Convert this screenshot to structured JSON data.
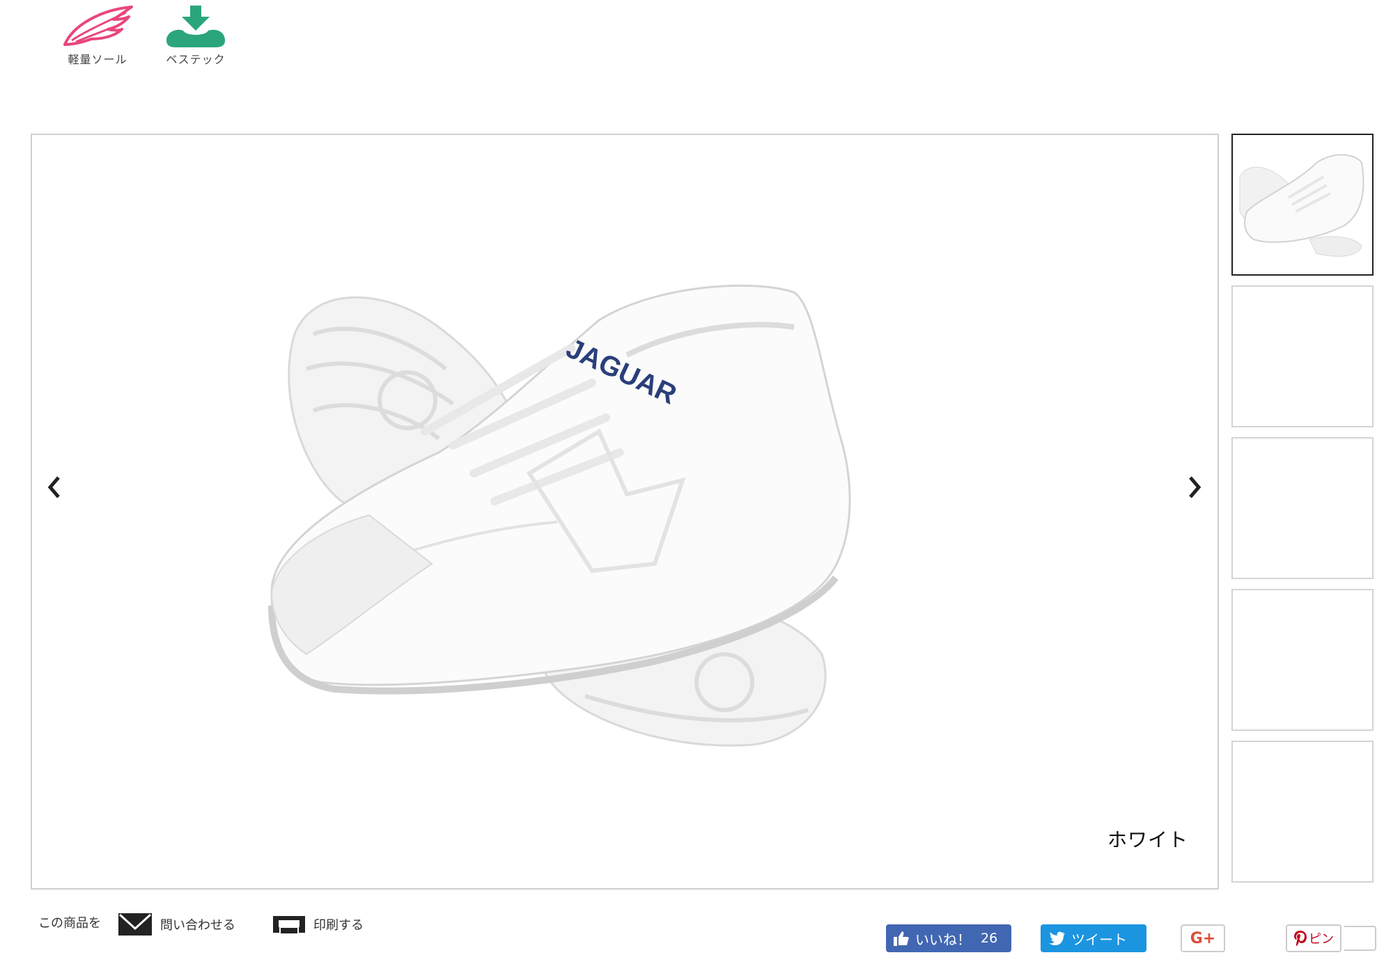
{
  "features": [
    {
      "label": "軽量ソール",
      "icon": "wing-icon",
      "color": "#e8467c"
    },
    {
      "label": "ベステック",
      "icon": "download-cloud-icon",
      "color": "#2aa57c"
    }
  ],
  "viewer": {
    "caption": "ホワイト",
    "prev_icon": "chevron-left-icon",
    "next_icon": "chevron-right-icon",
    "image": "white sneaker product photo",
    "brand_text": "JAGUAR",
    "thumbnail_count": 5,
    "active_thumbnail": 1
  },
  "actions": {
    "prefix": "この商品を",
    "contact": "問い合わせる",
    "print": "印刷する"
  },
  "social": {
    "facebook_label": "いいね！",
    "facebook_count": "26",
    "twitter_label": "ツイート",
    "google_label": "G+",
    "pinterest_label": "ピン"
  }
}
